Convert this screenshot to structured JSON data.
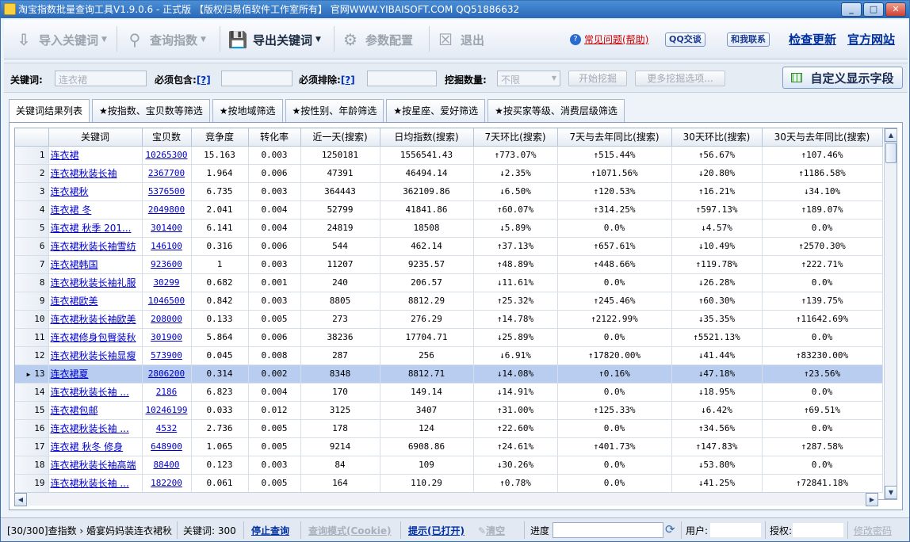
{
  "window": {
    "title": "淘宝指数批量查询工具V1.9.0.6 - 正式版 【版权归易佰软件工作室所有】 官网WWW.YIBAISOFT.COM QQ51886632",
    "min": "_",
    "max": "□",
    "close": "✕"
  },
  "toolbar": {
    "import": "导入关键词",
    "query": "查询指数",
    "export": "导出关键词",
    "params": "参数配置",
    "exit": "退出",
    "help": "常见问题(帮助)",
    "qq": "QQ交谈",
    "contact": "和我联系",
    "update": "检查更新",
    "site": "官方网站"
  },
  "filter": {
    "keyword_label": "关键词:",
    "keyword_value": "连衣裙",
    "must_include_label": "必须包含:",
    "must_exclude_label": "必须排除:",
    "help_mark": "[?]",
    "dig_count_label": "挖掘数量:",
    "dig_count_value": "不限",
    "start_btn": "开始挖掘",
    "more_btn": "更多挖掘选项...",
    "custom_btn": "自定义显示字段"
  },
  "tabs": [
    "关键词结果列表",
    "★按指数、宝贝数等筛选",
    "★按地域筛选",
    "★按性别、年龄筛选",
    "★按星座、爱好筛选",
    "★按买家等级、消费层级筛选"
  ],
  "columns": [
    "关键词",
    "宝贝数",
    "竞争度",
    "转化率",
    "近一天(搜索)",
    "日均指数(搜索)",
    "7天环比(搜索)",
    "7天与去年同比(搜索)",
    "30天环比(搜索)",
    "30天与去年同比(搜索)"
  ],
  "rows": [
    {
      "n": "1",
      "kw": "连衣裙",
      "cnt": "10265300",
      "comp": "15.163",
      "conv": "0.003",
      "day": "1250181",
      "avg": "1556541.43",
      "w7": "↑773.07%",
      "w7y": "↑515.44%",
      "m30": "↑56.67%",
      "m30y": "↑107.46%"
    },
    {
      "n": "2",
      "kw": "连衣裙秋装长袖",
      "cnt": "2367700",
      "comp": "1.964",
      "conv": "0.006",
      "day": "47391",
      "avg": "46494.14",
      "w7": "↓2.35%",
      "w7y": "↑1071.56%",
      "m30": "↓20.80%",
      "m30y": "↑1186.58%"
    },
    {
      "n": "3",
      "kw": "连衣裙秋",
      "cnt": "5376500",
      "comp": "6.735",
      "conv": "0.003",
      "day": "364443",
      "avg": "362109.86",
      "w7": "↓6.50%",
      "w7y": "↑120.53%",
      "m30": "↑16.21%",
      "m30y": "↓34.10%"
    },
    {
      "n": "4",
      "kw": "连衣裙 冬",
      "cnt": "2049800",
      "comp": "2.041",
      "conv": "0.004",
      "day": "52799",
      "avg": "41841.86",
      "w7": "↑60.07%",
      "w7y": "↑314.25%",
      "m30": "↑597.13%",
      "m30y": "↑189.07%"
    },
    {
      "n": "5",
      "kw": "连衣裙 秋季 201...",
      "cnt": "301400",
      "comp": "6.141",
      "conv": "0.004",
      "day": "24819",
      "avg": "18508",
      "w7": "↓5.89%",
      "w7y": "0.0%",
      "m30": "↓4.57%",
      "m30y": "0.0%"
    },
    {
      "n": "6",
      "kw": "连衣裙秋装长袖雪纺",
      "cnt": "146100",
      "comp": "0.316",
      "conv": "0.006",
      "day": "544",
      "avg": "462.14",
      "w7": "↑37.13%",
      "w7y": "↑657.61%",
      "m30": "↓10.49%",
      "m30y": "↑2570.30%"
    },
    {
      "n": "7",
      "kw": "连衣裙韩国",
      "cnt": "923600",
      "comp": "1",
      "conv": "0.003",
      "day": "11207",
      "avg": "9235.57",
      "w7": "↑48.89%",
      "w7y": "↑448.66%",
      "m30": "↑119.78%",
      "m30y": "↑222.71%"
    },
    {
      "n": "8",
      "kw": "连衣裙秋装长袖礼服",
      "cnt": "30299",
      "comp": "0.682",
      "conv": "0.001",
      "day": "240",
      "avg": "206.57",
      "w7": "↓11.61%",
      "w7y": "0.0%",
      "m30": "↓26.28%",
      "m30y": "0.0%"
    },
    {
      "n": "9",
      "kw": "连衣裙欧美",
      "cnt": "1046500",
      "comp": "0.842",
      "conv": "0.003",
      "day": "8805",
      "avg": "8812.29",
      "w7": "↑25.32%",
      "w7y": "↑245.46%",
      "m30": "↑60.30%",
      "m30y": "↑139.75%"
    },
    {
      "n": "10",
      "kw": "连衣裙秋装长袖欧美",
      "cnt": "208000",
      "comp": "0.133",
      "conv": "0.005",
      "day": "273",
      "avg": "276.29",
      "w7": "↑14.78%",
      "w7y": "↑2122.99%",
      "m30": "↓35.35%",
      "m30y": "↑11642.69%"
    },
    {
      "n": "11",
      "kw": "连衣裙修身包臀装秋",
      "cnt": "301900",
      "comp": "5.864",
      "conv": "0.006",
      "day": "38236",
      "avg": "17704.71",
      "w7": "↓25.89%",
      "w7y": "0.0%",
      "m30": "↑5521.13%",
      "m30y": "0.0%"
    },
    {
      "n": "12",
      "kw": "连衣裙秋装长袖显瘦",
      "cnt": "573900",
      "comp": "0.045",
      "conv": "0.008",
      "day": "287",
      "avg": "256",
      "w7": "↓6.91%",
      "w7y": "↑17820.00%",
      "m30": "↓41.44%",
      "m30y": "↑83230.00%"
    },
    {
      "n": "13",
      "kw": "连衣裙夏",
      "cnt": "2806200",
      "comp": "0.314",
      "conv": "0.002",
      "day": "8348",
      "avg": "8812.71",
      "w7": "↓14.08%",
      "w7y": "↑0.16%",
      "m30": "↓47.18%",
      "m30y": "↑23.56%"
    },
    {
      "n": "14",
      "kw": "连衣裙秋装长袖 ...",
      "cnt": "2186",
      "comp": "6.823",
      "conv": "0.004",
      "day": "170",
      "avg": "149.14",
      "w7": "↓14.91%",
      "w7y": "0.0%",
      "m30": "↓18.95%",
      "m30y": "0.0%"
    },
    {
      "n": "15",
      "kw": "连衣裙包邮",
      "cnt": "10246199",
      "comp": "0.033",
      "conv": "0.012",
      "day": "3125",
      "avg": "3407",
      "w7": "↑31.00%",
      "w7y": "↑125.33%",
      "m30": "↓6.42%",
      "m30y": "↑69.51%"
    },
    {
      "n": "16",
      "kw": "连衣裙秋装长袖 ...",
      "cnt": "4532",
      "comp": "2.736",
      "conv": "0.005",
      "day": "178",
      "avg": "124",
      "w7": "↑22.60%",
      "w7y": "0.0%",
      "m30": "↑34.56%",
      "m30y": "0.0%"
    },
    {
      "n": "17",
      "kw": "连衣裙 秋冬 修身",
      "cnt": "648900",
      "comp": "1.065",
      "conv": "0.005",
      "day": "9214",
      "avg": "6908.86",
      "w7": "↑24.61%",
      "w7y": "↑401.73%",
      "m30": "↑147.83%",
      "m30y": "↑287.58%"
    },
    {
      "n": "18",
      "kw": "连衣裙秋装长袖高端",
      "cnt": "88400",
      "comp": "0.123",
      "conv": "0.003",
      "day": "84",
      "avg": "109",
      "w7": "↓30.26%",
      "w7y": "0.0%",
      "m30": "↓53.80%",
      "m30y": "0.0%"
    },
    {
      "n": "19",
      "kw": "连衣裙秋装长袖 ...",
      "cnt": "182200",
      "comp": "0.061",
      "conv": "0.005",
      "day": "164",
      "avg": "110.29",
      "w7": "↑0.78%",
      "w7y": "0.0%",
      "m30": "↓41.25%",
      "m30y": "↑72841.18%"
    }
  ],
  "status": {
    "progress_text": "[30/300]查指数 › 婚宴妈妈装连衣裙秋",
    "kw_count": "关键词: 300",
    "stop": "停止查询",
    "mode": "查询模式(Cookie)",
    "tip": "提示(已打开)",
    "clear": "清空",
    "progress_label": "进度",
    "user_label": "用户:",
    "auth_label": "授权:",
    "change_pwd": "修改密码"
  }
}
